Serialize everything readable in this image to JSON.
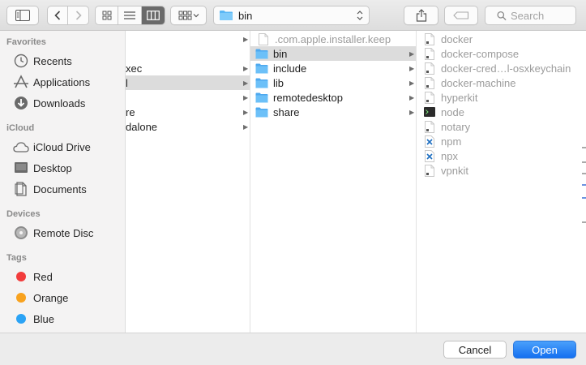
{
  "toolbar": {
    "location": "bin",
    "search_placeholder": "Search"
  },
  "sidebar": {
    "sections": [
      {
        "header": "Favorites",
        "items": [
          {
            "label": "Recents",
            "icon": "clock-icon"
          },
          {
            "label": "Applications",
            "icon": "applications-icon"
          },
          {
            "label": "Downloads",
            "icon": "downloads-icon"
          }
        ]
      },
      {
        "header": "iCloud",
        "items": [
          {
            "label": "iCloud Drive",
            "icon": "cloud-icon"
          },
          {
            "label": "Desktop",
            "icon": "desktop-icon"
          },
          {
            "label": "Documents",
            "icon": "documents-icon"
          }
        ]
      },
      {
        "header": "Devices",
        "items": [
          {
            "label": "Remote Disc",
            "icon": "disc-icon"
          }
        ]
      },
      {
        "header": "Tags",
        "items": [
          {
            "label": "Red",
            "color": "#f23c3c"
          },
          {
            "label": "Orange",
            "color": "#f8a21e"
          },
          {
            "label": "Blue",
            "color": "#2ba3f5"
          }
        ]
      }
    ]
  },
  "columns": {
    "col1": [
      {
        "name": "",
        "arrow": true,
        "selected": false
      },
      {
        "name": "xec",
        "arrow": true,
        "selected": false
      },
      {
        "name": "l",
        "arrow": true,
        "selected": true
      },
      {
        "name": "",
        "arrow": true,
        "selected": false
      },
      {
        "name": "re",
        "arrow": true,
        "selected": false
      },
      {
        "name": "dalone",
        "arrow": true,
        "selected": false
      }
    ],
    "col2": [
      {
        "name": ".com.apple.installer.keep",
        "type": "file",
        "dim": true,
        "arrow": false,
        "selected": false
      },
      {
        "name": "bin",
        "type": "folder",
        "dim": false,
        "arrow": true,
        "selected": true
      },
      {
        "name": "include",
        "type": "folder",
        "dim": false,
        "arrow": true,
        "selected": false
      },
      {
        "name": "lib",
        "type": "folder",
        "dim": false,
        "arrow": true,
        "selected": false
      },
      {
        "name": "remotedesktop",
        "type": "folder",
        "dim": false,
        "arrow": true,
        "selected": false
      },
      {
        "name": "share",
        "type": "folder",
        "dim": false,
        "arrow": true,
        "selected": false
      }
    ],
    "col3": [
      {
        "name": "docker",
        "type": "exec"
      },
      {
        "name": "docker-compose",
        "type": "exec"
      },
      {
        "name": "docker-cred…l-osxkeychain",
        "type": "exec"
      },
      {
        "name": "docker-machine",
        "type": "exec"
      },
      {
        "name": "hyperkit",
        "type": "exec"
      },
      {
        "name": "node",
        "type": "terminal"
      },
      {
        "name": "notary",
        "type": "exec"
      },
      {
        "name": "npm",
        "type": "vscode"
      },
      {
        "name": "npx",
        "type": "vscode"
      },
      {
        "name": "vpnkit",
        "type": "exec"
      }
    ]
  },
  "buttons": {
    "cancel": "Cancel",
    "open": "Open"
  },
  "colors": {
    "accent": "#1570f0",
    "folder": "#5ab7f5",
    "selection": "#dcdcdc"
  }
}
